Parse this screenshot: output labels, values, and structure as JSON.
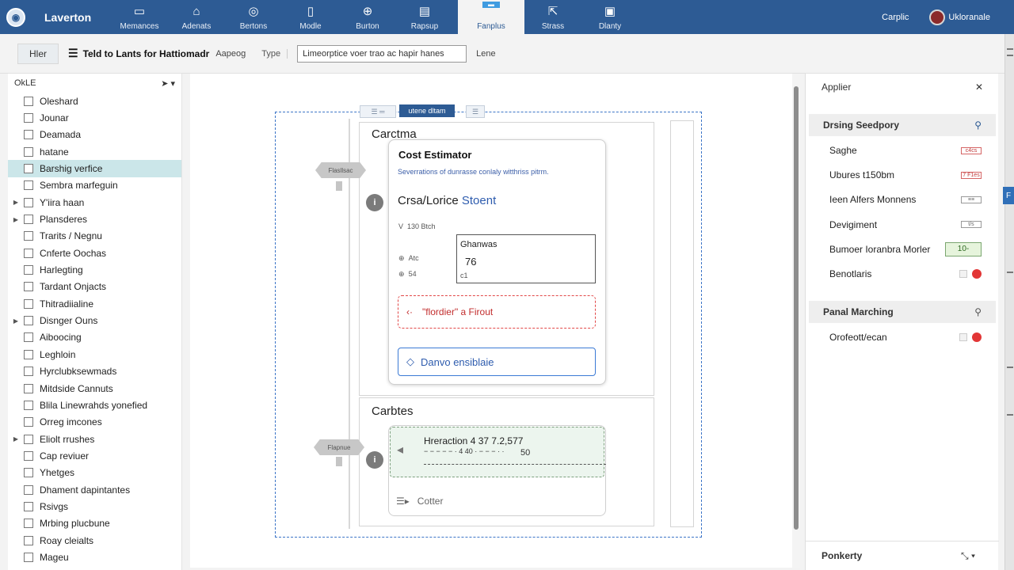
{
  "app": {
    "name": "Laverton"
  },
  "ribbon": [
    {
      "label": "Memances",
      "icon": "monitor-icon",
      "glyph": "▭"
    },
    {
      "label": "Adenats",
      "icon": "home-icon",
      "glyph": "⌂"
    },
    {
      "label": "Bertons",
      "icon": "globe-icon",
      "glyph": "◎"
    },
    {
      "label": "Modle",
      "icon": "document-icon",
      "glyph": "▯"
    },
    {
      "label": "Burton",
      "icon": "settings-icon",
      "glyph": "⊕"
    },
    {
      "label": "Rapsup",
      "icon": "window-icon",
      "glyph": "▤"
    },
    {
      "label": "Fanplus",
      "icon": "panel-icon",
      "glyph": "▬"
    },
    {
      "label": "Strass",
      "icon": "cursor-icon",
      "glyph": "⇱"
    },
    {
      "label": "Dlanty",
      "icon": "image-icon",
      "glyph": "▣"
    }
  ],
  "top_right": {
    "item": "Carplic",
    "user": "Ukloranale"
  },
  "toolbar": {
    "filter": "Hler",
    "title": "Teld to Lants for Hattiomadr",
    "subtitle": "Aapeog",
    "type": "Type",
    "search_value": "Limeorptice voer trao ac hapir hanes",
    "lens": "Lene"
  },
  "left_panel": {
    "header": "OkLE",
    "items": [
      {
        "label": "Oleshard",
        "expand": false,
        "selected": false
      },
      {
        "label": "Jounar",
        "expand": false,
        "selected": false
      },
      {
        "label": "Deamada",
        "expand": false,
        "selected": false
      },
      {
        "label": "hatane",
        "expand": false,
        "selected": false
      },
      {
        "label": "Barshig verfice",
        "expand": false,
        "selected": true
      },
      {
        "label": "Sembra marfeguin",
        "expand": false,
        "selected": false
      },
      {
        "label": "Y'iira haan",
        "expand": true,
        "selected": false
      },
      {
        "label": "Plansderes",
        "expand": true,
        "selected": false
      },
      {
        "label": "Trarits / Negnu",
        "expand": false,
        "selected": false
      },
      {
        "label": "Cnferte Oochas",
        "expand": false,
        "selected": false
      },
      {
        "label": "Harlegting",
        "expand": false,
        "selected": false
      },
      {
        "label": "Tardant Onjacts",
        "expand": false,
        "selected": false
      },
      {
        "label": "Thitradiialine",
        "expand": false,
        "selected": false
      },
      {
        "label": "Disnger Ouns",
        "expand": true,
        "selected": false
      },
      {
        "label": "Aiboocing",
        "expand": false,
        "selected": false
      },
      {
        "label": "Leghloin",
        "expand": false,
        "selected": false
      },
      {
        "label": "Hyrclubksewmads",
        "expand": false,
        "selected": false
      },
      {
        "label": "Mitdside Cannuts",
        "expand": false,
        "selected": false
      },
      {
        "label": "Blila Linewrahds yonefied",
        "expand": false,
        "selected": false
      },
      {
        "label": "Orreg imcones",
        "expand": false,
        "selected": false
      },
      {
        "label": "Eliolt rrushes",
        "expand": true,
        "selected": false
      },
      {
        "label": "Cap reviuer",
        "expand": false,
        "selected": false
      },
      {
        "label": "Yhetges",
        "expand": false,
        "selected": false
      },
      {
        "label": "Dhament dapintantes",
        "expand": false,
        "selected": false
      },
      {
        "label": "Rsivgs",
        "expand": false,
        "selected": false
      },
      {
        "label": "Mrbing plucbune",
        "expand": false,
        "selected": false
      },
      {
        "label": "Roay cleialts",
        "expand": false,
        "selected": false
      },
      {
        "label": "Mageu",
        "expand": false,
        "selected": false
      }
    ]
  },
  "canvas": {
    "frame_tabs": [
      "☰ ═",
      "utene dltam",
      "☰"
    ],
    "section1": {
      "title": "Carctma",
      "node": "Flasllsac",
      "badge": "i",
      "card": {
        "title": "Cost Estimator",
        "desc": "Severrations of dunrasse conlaly witthriss pitrm.",
        "sub_main": "Crsa/Lorice",
        "sub_accent": "Stoent",
        "rows": [
          {
            "icon": "V",
            "label": "130 Btch"
          },
          {
            "icon": "⊕",
            "label": "Atc"
          },
          {
            "icon": "⊕",
            "label": "54"
          }
        ],
        "box_label": "Ghanwas",
        "box_value": "76",
        "box_note": "c1",
        "warning": "\"flordier\" a Firout",
        "button": "Danvo ensiblaie"
      }
    },
    "section2": {
      "title": "Carbtes",
      "node": "Flapnue",
      "badge": "i",
      "green_title": "Hreraction 4 37 7.2,577",
      "green_sub": "− − − − − · 4 40 · − − − · ·",
      "green_value": "50",
      "footer": "Cotter",
      "footer_icon": "☰▸"
    }
  },
  "properties": {
    "title": "Applier",
    "section1": "Drsing Seedpory",
    "rows1": [
      {
        "label": "Saghe",
        "value": "c4cs",
        "kind": "chip"
      },
      {
        "label": "Ubures t150bm",
        "value": "7 F1es",
        "kind": "chip"
      },
      {
        "label": "Ieen Alfers Monnens",
        "value": "≡≡",
        "kind": "grey"
      },
      {
        "label": "Devigiment",
        "value": "t/s",
        "kind": "grey"
      },
      {
        "label": "Bumoer Ioranbra Morler",
        "value": "10-",
        "kind": "green"
      },
      {
        "label": "Benotlaris",
        "value": "",
        "kind": "toggle"
      }
    ],
    "section2": "Panal Marching",
    "rows2": [
      {
        "label": "Orofeott/ecan",
        "value": "",
        "kind": "toggle"
      }
    ],
    "footer": "Ponkerty"
  }
}
